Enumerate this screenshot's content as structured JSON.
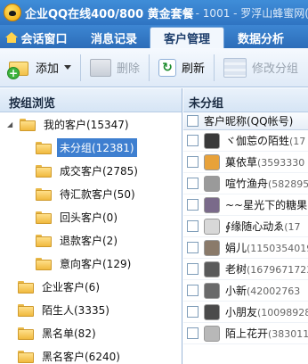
{
  "window": {
    "title_main": "企业QQ在线400/800 黄金套餐",
    "title_sub": "- 1001 - 罗浮山蜂蜜网(8000"
  },
  "tabs": [
    {
      "label": "会话窗口",
      "active": false
    },
    {
      "label": "消息记录",
      "active": false
    },
    {
      "label": "客户管理",
      "active": true
    },
    {
      "label": "数据分析",
      "active": false
    }
  ],
  "toolbar": {
    "add_label": "添加",
    "delete_label": "删除",
    "refresh_label": "刷新",
    "modify_group_label": "修改分组"
  },
  "left_panel": {
    "header": "按组浏览",
    "tree": [
      {
        "label": "我的客户(15347)",
        "level": 0,
        "expanded": true,
        "selected": false
      },
      {
        "label": "未分组(12381)",
        "level": 1,
        "selected": true
      },
      {
        "label": "成交客户(2785)",
        "level": 1,
        "selected": false
      },
      {
        "label": "待汇款客户(50)",
        "level": 1,
        "selected": false
      },
      {
        "label": "回头客户(0)",
        "level": 1,
        "selected": false
      },
      {
        "label": "退款客户(2)",
        "level": 1,
        "selected": false
      },
      {
        "label": "意向客户(129)",
        "level": 1,
        "selected": false
      },
      {
        "label": "企业客户(6)",
        "level": 0,
        "selected": false
      },
      {
        "label": "陌生人(3335)",
        "level": 0,
        "selected": false
      },
      {
        "label": "黑名单(82)",
        "level": 0,
        "selected": false
      },
      {
        "label": "黑名客户(6240)",
        "level": 0,
        "selected": false
      }
    ]
  },
  "right_panel": {
    "header": "未分组",
    "column_header": "客户昵称(QQ帐号)",
    "rows": [
      {
        "name": "ヾ伽莣の陌甡",
        "qq": "(17",
        "avatar_color": "#3a3a3a"
      },
      {
        "name": "菓依草",
        "qq": "(3593330",
        "avatar_color": "#e8a23a"
      },
      {
        "name": "喧竹渔舟",
        "qq": "(582895",
        "avatar_color": "#9a9a9a"
      },
      {
        "name": "~~星光下的糖果",
        "qq": "",
        "avatar_color": "#7a6a8a"
      },
      {
        "name": "∮缘随心动ゑ",
        "qq": "(17",
        "avatar_color": "#d8d8d8"
      },
      {
        "name": "娟儿",
        "qq": "(11503540195",
        "avatar_color": "#8a7a6a"
      },
      {
        "name": "老树",
        "qq": "(1679671723",
        "avatar_color": "#5a5a5a"
      },
      {
        "name": "小新",
        "qq": "(42002763",
        "avatar_color": "#6a6a6a"
      },
      {
        "name": "小朋友",
        "qq": "(100989288",
        "avatar_color": "#4a4a4a"
      },
      {
        "name": "陌上花开",
        "qq": "(3830111",
        "avatar_color": "#b8b8b8"
      }
    ]
  }
}
